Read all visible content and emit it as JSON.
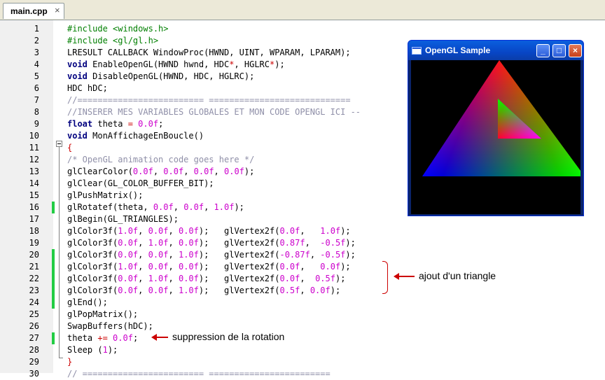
{
  "tab": {
    "label": "main.cpp",
    "close": "×"
  },
  "lines": [
    {
      "n": "1",
      "mark": false,
      "tokens": [
        [
          "pp",
          "#include <windows.h>"
        ]
      ]
    },
    {
      "n": "2",
      "mark": false,
      "tokens": [
        [
          "pp",
          "#include <gl/gl.h>"
        ]
      ]
    },
    {
      "n": "3",
      "mark": false,
      "tokens": [
        [
          "",
          "LRESULT CALLBACK WindowProc(HWND, UINT, WPARAM, LPARAM);"
        ]
      ]
    },
    {
      "n": "4",
      "mark": false,
      "tokens": [
        [
          "kw",
          "void"
        ],
        [
          "",
          " EnableOpenGL(HWND hwnd, HDC"
        ],
        [
          "op",
          "*"
        ],
        [
          "",
          ", HGLRC"
        ],
        [
          "op",
          "*"
        ],
        [
          "",
          ");"
        ]
      ]
    },
    {
      "n": "5",
      "mark": false,
      "tokens": [
        [
          "kw",
          "void"
        ],
        [
          "",
          " DisableOpenGL(HWND, HDC, HGLRC);"
        ]
      ]
    },
    {
      "n": "6",
      "mark": false,
      "tokens": [
        [
          "",
          "HDC hDC;"
        ]
      ]
    },
    {
      "n": "7",
      "mark": false,
      "tokens": [
        [
          "cm",
          "//========================= ============================"
        ]
      ]
    },
    {
      "n": "8",
      "mark": false,
      "tokens": [
        [
          "cm",
          "//INSERER MES VARIABLES GLOBALES ET MON CODE OPENGL ICI --"
        ]
      ]
    },
    {
      "n": "9",
      "mark": false,
      "tokens": [
        [
          "kw",
          "float"
        ],
        [
          "",
          " theta "
        ],
        [
          "op",
          "="
        ],
        [
          "num",
          " 0.0f"
        ],
        [
          "",
          ";"
        ]
      ]
    },
    {
      "n": "10",
      "mark": false,
      "tokens": [
        [
          "kw",
          "void"
        ],
        [
          "",
          " MonAffichageEnBoucle()"
        ]
      ]
    },
    {
      "n": "11",
      "mark": false,
      "tokens": [
        [
          "op",
          "{"
        ]
      ]
    },
    {
      "n": "12",
      "mark": false,
      "tokens": [
        [
          "cm",
          "/* OpenGL animation code goes here */"
        ]
      ]
    },
    {
      "n": "13",
      "mark": false,
      "tokens": [
        [
          "",
          "glClearColor("
        ],
        [
          "num",
          "0.0f"
        ],
        [
          "",
          ", "
        ],
        [
          "num",
          "0.0f"
        ],
        [
          "",
          ", "
        ],
        [
          "num",
          "0.0f"
        ],
        [
          "",
          ", "
        ],
        [
          "num",
          "0.0f"
        ],
        [
          "",
          ");"
        ]
      ]
    },
    {
      "n": "14",
      "mark": false,
      "tokens": [
        [
          "",
          "glClear(GL_COLOR_BUFFER_BIT);"
        ]
      ]
    },
    {
      "n": "15",
      "mark": false,
      "tokens": [
        [
          "",
          "glPushMatrix();"
        ]
      ]
    },
    {
      "n": "16",
      "mark": true,
      "tokens": [
        [
          "",
          "glRotatef(theta, "
        ],
        [
          "num",
          "0.0f"
        ],
        [
          "",
          ", "
        ],
        [
          "num",
          "0.0f"
        ],
        [
          "",
          ", "
        ],
        [
          "num",
          "1.0f"
        ],
        [
          "",
          ");"
        ]
      ]
    },
    {
      "n": "17",
      "mark": false,
      "tokens": [
        [
          "",
          "glBegin(GL_TRIANGLES);"
        ]
      ]
    },
    {
      "n": "18",
      "mark": false,
      "tokens": [
        [
          "",
          "glColor3f("
        ],
        [
          "num",
          "1.0f"
        ],
        [
          "",
          ", "
        ],
        [
          "num",
          "0.0f"
        ],
        [
          "",
          ", "
        ],
        [
          "num",
          "0.0f"
        ],
        [
          "",
          ");   glVertex2f("
        ],
        [
          "num",
          "0.0f"
        ],
        [
          "",
          ",   "
        ],
        [
          "num",
          "1.0f"
        ],
        [
          "",
          ");"
        ]
      ]
    },
    {
      "n": "19",
      "mark": false,
      "tokens": [
        [
          "",
          "glColor3f("
        ],
        [
          "num",
          "0.0f"
        ],
        [
          "",
          ", "
        ],
        [
          "num",
          "1.0f"
        ],
        [
          "",
          ", "
        ],
        [
          "num",
          "0.0f"
        ],
        [
          "",
          ");   glVertex2f("
        ],
        [
          "num",
          "0.87f"
        ],
        [
          "",
          ",  "
        ],
        [
          "num",
          "-0.5f"
        ],
        [
          "",
          ");"
        ]
      ]
    },
    {
      "n": "20",
      "mark": true,
      "tokens": [
        [
          "",
          "glColor3f("
        ],
        [
          "num",
          "0.0f"
        ],
        [
          "",
          ", "
        ],
        [
          "num",
          "0.0f"
        ],
        [
          "",
          ", "
        ],
        [
          "num",
          "1.0f"
        ],
        [
          "",
          ");   glVertex2f("
        ],
        [
          "num",
          "-0.87f"
        ],
        [
          "",
          ", "
        ],
        [
          "num",
          "-0.5f"
        ],
        [
          "",
          ");"
        ]
      ]
    },
    {
      "n": "21",
      "mark": true,
      "tokens": [
        [
          "",
          "glColor3f("
        ],
        [
          "num",
          "1.0f"
        ],
        [
          "",
          ", "
        ],
        [
          "num",
          "0.0f"
        ],
        [
          "",
          ", "
        ],
        [
          "num",
          "0.0f"
        ],
        [
          "",
          ");   glVertex2f("
        ],
        [
          "num",
          "0.0f"
        ],
        [
          "",
          ",   "
        ],
        [
          "num",
          "0.0f"
        ],
        [
          "",
          ");"
        ]
      ]
    },
    {
      "n": "22",
      "mark": true,
      "tokens": [
        [
          "",
          "glColor3f("
        ],
        [
          "num",
          "0.0f"
        ],
        [
          "",
          ", "
        ],
        [
          "num",
          "1.0f"
        ],
        [
          "",
          ", "
        ],
        [
          "num",
          "0.0f"
        ],
        [
          "",
          ");   glVertex2f("
        ],
        [
          "num",
          "0.0f"
        ],
        [
          "",
          ",  "
        ],
        [
          "num",
          "0.5f"
        ],
        [
          "",
          ");"
        ]
      ]
    },
    {
      "n": "23",
      "mark": true,
      "tokens": [
        [
          "",
          "glColor3f("
        ],
        [
          "num",
          "0.0f"
        ],
        [
          "",
          ", "
        ],
        [
          "num",
          "0.0f"
        ],
        [
          "",
          ", "
        ],
        [
          "num",
          "1.0f"
        ],
        [
          "",
          ");   glVertex2f("
        ],
        [
          "num",
          "0.5f"
        ],
        [
          "",
          ", "
        ],
        [
          "num",
          "0.0f"
        ],
        [
          "",
          ");"
        ]
      ]
    },
    {
      "n": "24",
      "mark": true,
      "tokens": [
        [
          "",
          "glEnd();"
        ]
      ]
    },
    {
      "n": "25",
      "mark": false,
      "tokens": [
        [
          "",
          "glPopMatrix();"
        ]
      ]
    },
    {
      "n": "26",
      "mark": false,
      "tokens": [
        [
          "",
          "SwapBuffers(hDC);"
        ]
      ]
    },
    {
      "n": "27",
      "mark": true,
      "tokens": [
        [
          "",
          "theta "
        ],
        [
          "op",
          "+="
        ],
        [
          "num",
          " 0.0f"
        ],
        [
          "",
          ";"
        ]
      ]
    },
    {
      "n": "28",
      "mark": false,
      "tokens": [
        [
          "",
          "Sleep ("
        ],
        [
          "num",
          "1"
        ],
        [
          "",
          ");"
        ]
      ]
    },
    {
      "n": "29",
      "mark": false,
      "tokens": [
        [
          "op",
          "}"
        ]
      ]
    },
    {
      "n": "30",
      "mark": false,
      "tokens": [
        [
          "cm",
          "// ======================== ========================"
        ]
      ]
    }
  ],
  "annotations": {
    "triangle_added": "ajout d'un triangle",
    "rotation_removed": "suppression de la rotation"
  },
  "window": {
    "title": "OpenGL Sample",
    "minimize": "_",
    "maximize": "□",
    "close": "×"
  },
  "colors": {
    "keyword": "#00007f",
    "preprocessor": "#007f00",
    "comment": "#8f8fa8",
    "number": "#cc00cc",
    "operator": "#cc0000",
    "change_marker": "#22cc44",
    "annotation_arrow": "#cc0000"
  }
}
